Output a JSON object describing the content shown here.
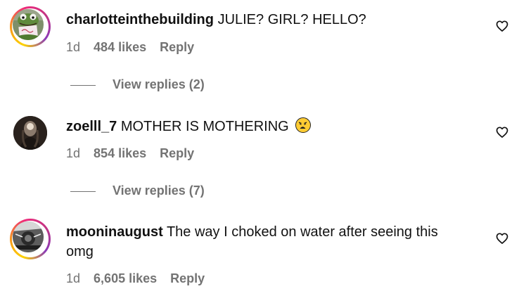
{
  "comments": [
    {
      "username": "charlotteinthebuilding",
      "text": "JULIE? GIRL? HELLO?",
      "time": "1d",
      "likes": "484 likes",
      "reply_label": "Reply",
      "view_replies": "View replies (2)",
      "avatar_icon": "kermit-avatar",
      "story_ring": true
    },
    {
      "username": "zoelll_7",
      "text": "MOTHER IS MOTHERING",
      "emoji": "weary-face-emoji",
      "time": "1d",
      "likes": "854 likes",
      "reply_label": "Reply",
      "view_replies": "View replies (7)",
      "avatar_icon": "dark-portrait-avatar",
      "story_ring": false
    },
    {
      "username": "mooninaugust",
      "text": "The way I choked on water after seeing this omg",
      "time": "1d",
      "likes": "6,605 likes",
      "reply_label": "Reply",
      "avatar_icon": "bw-photo-avatar",
      "story_ring": true
    }
  ],
  "colors": {
    "text": "#111111",
    "muted": "#737373",
    "ring_gradient": [
      "#fdd400",
      "#f7941d",
      "#ee2a7b",
      "#c13584",
      "#8a3ab9"
    ]
  }
}
